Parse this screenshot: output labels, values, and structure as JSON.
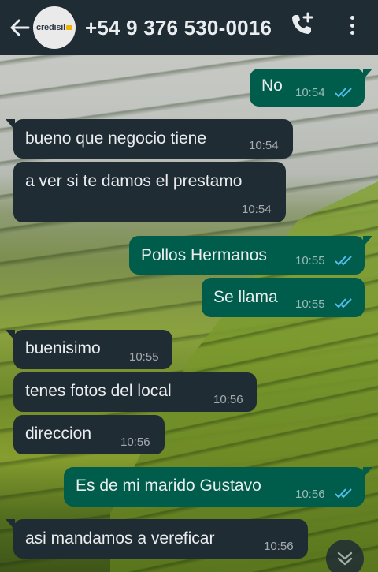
{
  "header": {
    "contact_name": "+54 9 376 530-0016",
    "avatar_logo_text": "credisil"
  },
  "messages": [
    {
      "direction": "outgoing",
      "text": "No",
      "time": "10:54",
      "status": "read"
    },
    {
      "direction": "incoming",
      "text": "bueno que negocio tiene",
      "time": "10:54"
    },
    {
      "direction": "incoming",
      "text": "a ver si te damos el prestamo",
      "time": "10:54"
    },
    {
      "direction": "outgoing",
      "text": "Pollos Hermanos",
      "time": "10:55",
      "status": "read"
    },
    {
      "direction": "outgoing",
      "text": "Se llama",
      "time": "10:55",
      "status": "read"
    },
    {
      "direction": "incoming",
      "text": "buenisimo",
      "time": "10:55"
    },
    {
      "direction": "incoming",
      "text": "tenes fotos del local",
      "time": "10:56"
    },
    {
      "direction": "incoming",
      "text": "direccion",
      "time": "10:56"
    },
    {
      "direction": "outgoing",
      "text": "Es de mi marido Gustavo",
      "time": "10:56",
      "status": "read"
    },
    {
      "direction": "incoming",
      "text": "asi  mandamos a vereficar",
      "time": "10:56"
    }
  ],
  "icons": {
    "back": "arrow-left-icon",
    "call_add": "phone-plus-icon",
    "menu": "three-dots-vertical-icon",
    "scroll": "chevron-double-down-icon",
    "read_receipt": "double-check-icon"
  },
  "colors": {
    "header_bg": "#1f2c34",
    "incoming_bubble": "#202c33",
    "outgoing_bubble": "#005c4b",
    "read_check": "#53bdeb"
  }
}
